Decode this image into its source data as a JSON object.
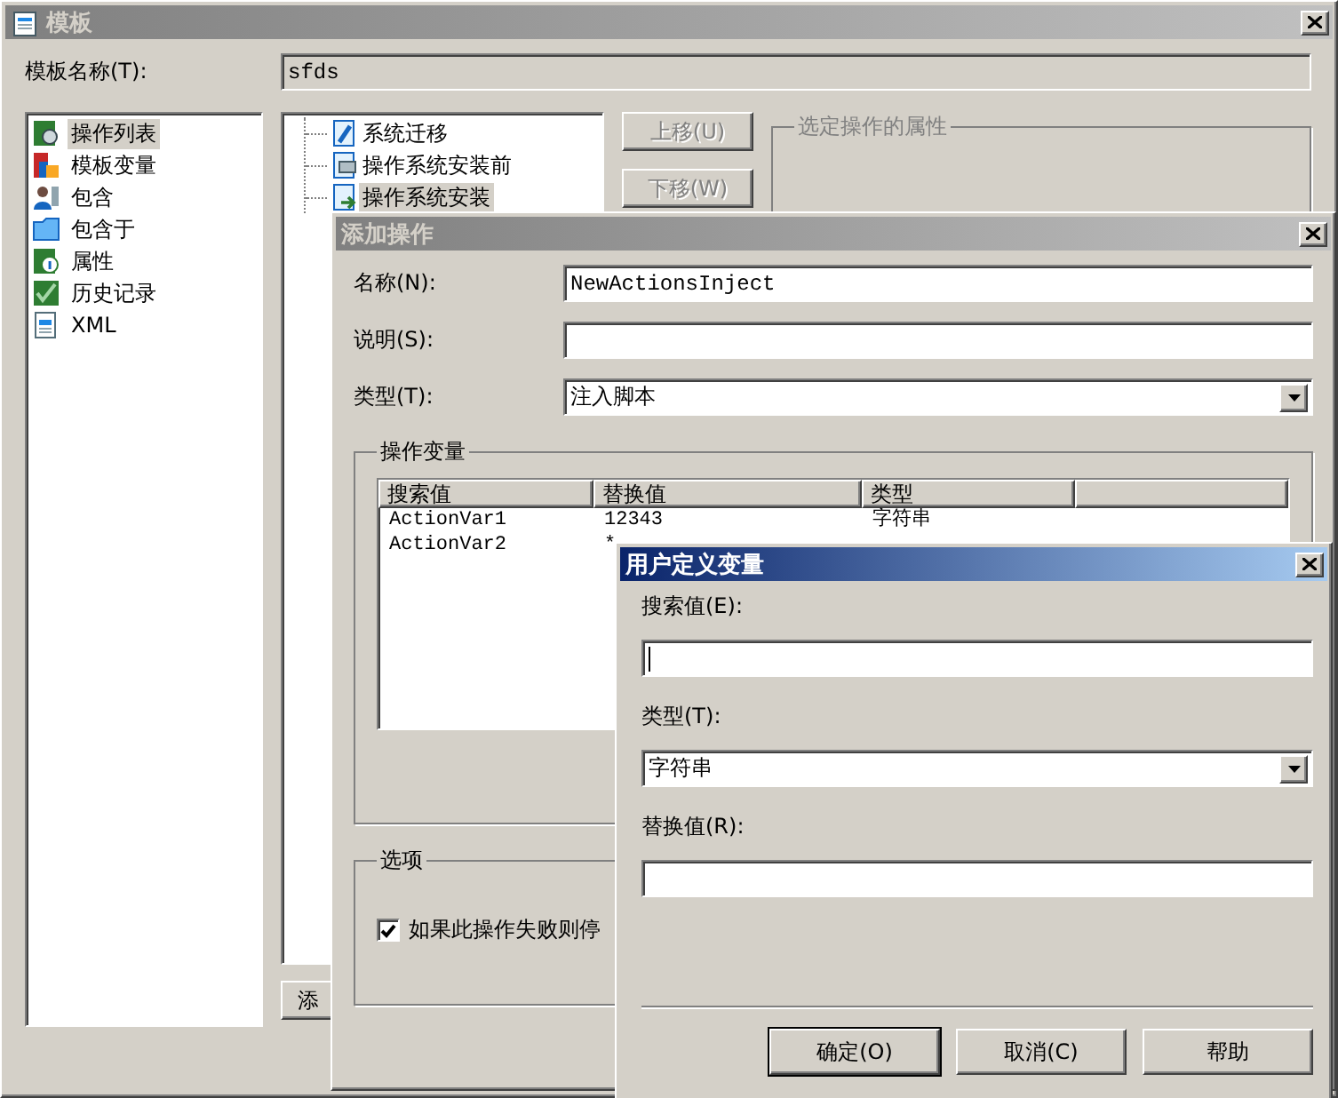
{
  "window": {
    "title": "模板",
    "active": false
  },
  "template_name": {
    "label": "模板名称(T):",
    "value": "sfds"
  },
  "sidebar": {
    "items": [
      {
        "label": "操作列表",
        "kind": "gear",
        "selected": true
      },
      {
        "label": "模板变量",
        "kind": "blocks",
        "selected": false
      },
      {
        "label": "包含",
        "kind": "user",
        "selected": false
      },
      {
        "label": "包含于",
        "kind": "folder",
        "selected": false
      },
      {
        "label": "属性",
        "kind": "info",
        "selected": false
      },
      {
        "label": "历史记录",
        "kind": "history",
        "selected": false
      },
      {
        "label": "XML",
        "kind": "document",
        "selected": false
      }
    ]
  },
  "action_tree": {
    "items": [
      {
        "label": "系统迁移",
        "kind": "tools",
        "selected": false
      },
      {
        "label": "操作系统安装前",
        "kind": "monitor",
        "selected": false
      },
      {
        "label": "操作系统安装",
        "kind": "install",
        "selected": true
      }
    ]
  },
  "move_buttons": [
    {
      "label": "上移(U)",
      "disabled": true
    },
    {
      "label": "下移(W)",
      "disabled": true
    }
  ],
  "properties_group": {
    "title": "选定操作的属性"
  },
  "add_button": {
    "label": "添"
  },
  "add_action_dialog": {
    "title": "添加操作",
    "active": false,
    "fields": [
      {
        "label": "名称(N):",
        "kind": "text",
        "value": "NewActionsInject"
      },
      {
        "label": "说明(S):",
        "kind": "text"
      },
      {
        "label": "类型(T):",
        "kind": "select",
        "value": "注入脚本"
      }
    ],
    "variables_group": {
      "title": "操作变量",
      "columns": [
        "搜索值",
        "替换值",
        "类型"
      ],
      "rows": [
        [
          "ActionVar1",
          "12343",
          "字符串"
        ],
        [
          "ActionVar2",
          "*"
        ]
      ]
    },
    "options_group": {
      "title": "选项",
      "checkbox": {
        "label": "如果此操作失败则停",
        "checked": true
      }
    }
  },
  "variable_dialog": {
    "title": "用户定义变量",
    "active": true,
    "fields": [
      {
        "label": "搜索值(E):",
        "kind": "text",
        "focused": true
      },
      {
        "label": "类型(T):",
        "kind": "select",
        "value": "字符串"
      },
      {
        "label": "替换值(R):",
        "kind": "text"
      }
    ],
    "buttons": [
      {
        "label": "确定(O)",
        "default": true
      },
      {
        "label": "取消(C)",
        "default": false
      },
      {
        "label": "帮助",
        "default": false
      }
    ]
  }
}
